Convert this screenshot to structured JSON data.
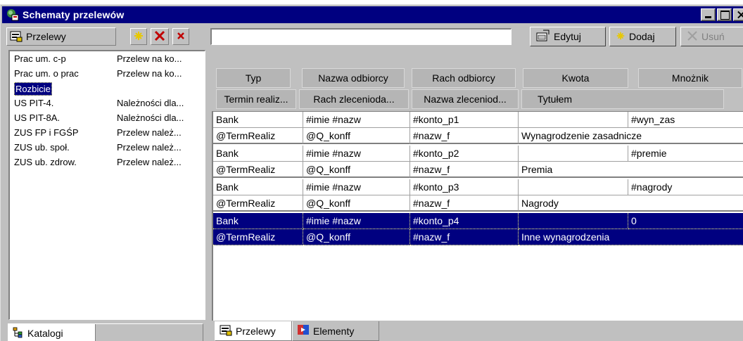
{
  "window": {
    "title": "Schematy przelewów"
  },
  "left": {
    "toolbar_label": "Przelewy",
    "items": [
      {
        "name": "Prac um. c-p",
        "desc": "Przelew na ko..."
      },
      {
        "name": "Prac um. o prac",
        "desc": "Przelew na ko..."
      },
      {
        "name": "Rozbicie",
        "desc": ""
      },
      {
        "name": "US PIT-4.",
        "desc": "Należności dla..."
      },
      {
        "name": "US PIT-8A.",
        "desc": "Należności dla..."
      },
      {
        "name": "ZUS FP i FGŚP",
        "desc": "Przelew należ..."
      },
      {
        "name": "ZUS ub. społ.",
        "desc": "Przelew należ..."
      },
      {
        "name": "ZUS ub. zdrow.",
        "desc": "Przelew należ..."
      }
    ],
    "bottom_tab": "Katalogi"
  },
  "right": {
    "search_value": "",
    "buttons": {
      "edit": "Edytuj",
      "add": "Dodaj",
      "delete": "Usuń"
    },
    "headers_row1": [
      "Typ",
      "Nazwa odbiorcy",
      "Rach odbiorcy",
      "Kwota",
      "Mnożnik"
    ],
    "headers_row2": [
      "Termin realiz...",
      "Rach zlecenioda...",
      "Nazwa zleceniod...",
      "Tytułem"
    ],
    "rows": [
      [
        "Bank",
        "#imie #nazw",
        "#konto_p1",
        "",
        "#wyn_zas"
      ],
      [
        "@TermRealiz",
        "@Q_konff",
        "#nazw_f",
        "Wynagrodzenie zasadnicze",
        ""
      ],
      [
        "Bank",
        "#imie #nazw",
        "#konto_p2",
        "",
        "#premie"
      ],
      [
        "@TermRealiz",
        "@Q_konff",
        "#nazw_f",
        "Premia",
        ""
      ],
      [
        "Bank",
        "#imie #nazw",
        "#konto_p3",
        "",
        "#nagrody"
      ],
      [
        "@TermRealiz",
        "@Q_konff",
        "#nazw_f",
        "Nagrody",
        ""
      ],
      [
        "Bank",
        "#imie #nazw",
        "#konto_p4",
        "",
        "0"
      ],
      [
        "@TermRealiz",
        "@Q_konff",
        "#nazw_f",
        "Inne wynagrodzenia",
        ""
      ]
    ],
    "tabs": [
      "Przelewy",
      "Elementy"
    ]
  },
  "colors": {
    "title_bar": "#000080",
    "selection": "#000080",
    "face": "#c0c0c0"
  }
}
